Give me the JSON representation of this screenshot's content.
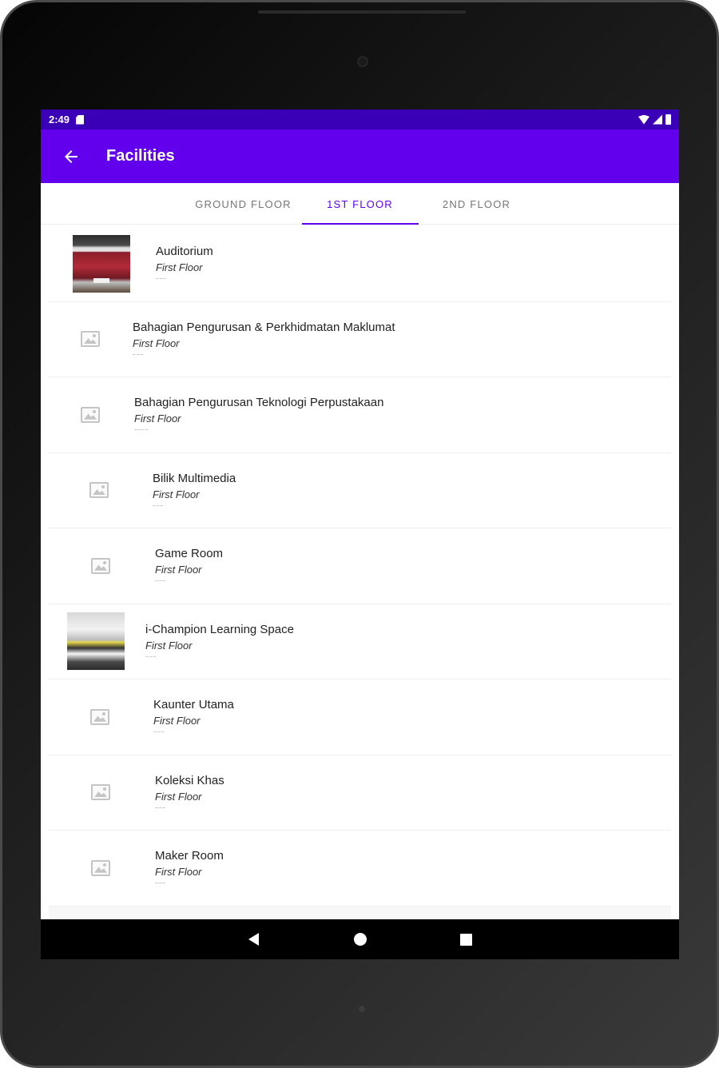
{
  "status_bar": {
    "time": "2:49"
  },
  "app_bar": {
    "title": "Facilities",
    "back_icon": "arrow-back-icon"
  },
  "tabs": [
    {
      "label": "GROUND FLOOR",
      "active": false
    },
    {
      "label": "1ST FLOOR",
      "active": true
    },
    {
      "label": "2ND FLOOR",
      "active": false
    }
  ],
  "facilities": [
    {
      "name": "Auditorium",
      "floor": "First Floor",
      "note": "~~~",
      "image": "auditorium-photo"
    },
    {
      "name": "Bahagian Pengurusan & Perkhidmatan Maklumat",
      "floor": "First Floor",
      "note": "~~~",
      "image": "image-placeholder-icon"
    },
    {
      "name": "Bahagian Pengurusan Teknologi Perpustakaan",
      "floor": "First Floor",
      "note": "~~~~",
      "image": "image-placeholder-icon"
    },
    {
      "name": "Bilik Multimedia",
      "floor": "First Floor",
      "note": "~~~",
      "image": "image-placeholder-icon"
    },
    {
      "name": "Game Room",
      "floor": "First Floor",
      "note": "~~~",
      "image": "image-placeholder-icon"
    },
    {
      "name": "i-Champion Learning Space",
      "floor": "First Floor",
      "note": "~~~",
      "image": "ichampion-photo"
    },
    {
      "name": "Kaunter Utama",
      "floor": "First Floor",
      "note": "~~~",
      "image": "image-placeholder-icon"
    },
    {
      "name": "Koleksi Khas",
      "floor": "First Floor",
      "note": "~~~",
      "image": "image-placeholder-icon"
    },
    {
      "name": "Maker Room",
      "floor": "First Floor",
      "note": "~~~",
      "image": "image-placeholder-icon"
    }
  ],
  "nav_bar": {
    "back": "nav-back-icon",
    "home": "nav-home-icon",
    "recents": "nav-recents-icon"
  },
  "colors": {
    "primary": "#6200ee",
    "status_bar": "#3a00b8"
  }
}
